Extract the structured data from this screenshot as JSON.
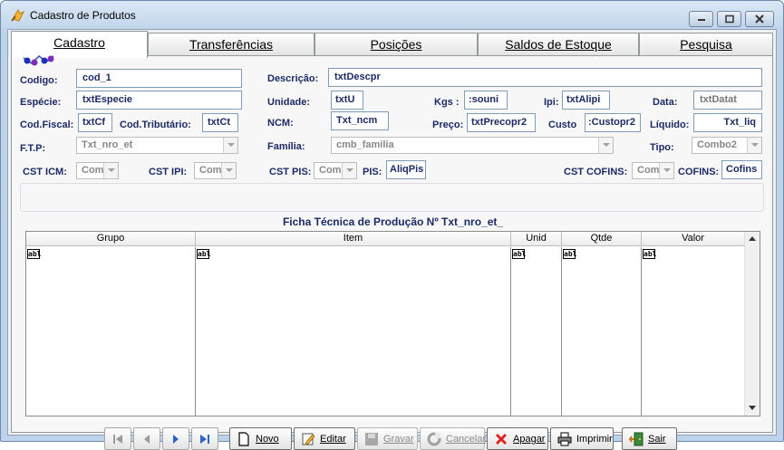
{
  "window": {
    "title": "Cadastro de Produtos"
  },
  "tabs": [
    {
      "label": "Cadastro"
    },
    {
      "label": "Transferências"
    },
    {
      "label": "Posições"
    },
    {
      "label": "Saldos de Estoque"
    },
    {
      "label": "Pesquisa"
    }
  ],
  "labels": {
    "codigo": "Codigo:",
    "descricao": "Descrição:",
    "especie": "Espécie:",
    "unidade": "Unidade:",
    "kgs": "Kgs :",
    "ipi": "Ipi:",
    "data": "Data:",
    "cod_fiscal": "Cod.Fiscal:",
    "cod_tributario": "Cod.Tributário:",
    "ncm": "NCM:",
    "preco": "Preço:",
    "custo": "Custo",
    "liquido": "Líquido:",
    "ftp": "F.T.P:",
    "familia": "Família:",
    "tipo": "Tipo:",
    "cst_icm": "CST ICM:",
    "cst_ipi": "CST IPI:",
    "cst_pis": "CST PIS:",
    "pis": "PIS:",
    "cst_cofins": "CST COFINS:",
    "cofins": "COFINS:"
  },
  "fields": {
    "codigo": "cod_1",
    "descricao": "txtDescpr",
    "especie": "txtEspecie",
    "unidade": "txtU",
    "kgs": ":souni",
    "ipi": "txtAlipi",
    "data": "txtDatat",
    "cod_fiscal": "txtCf",
    "cod_tributario": "txtCt",
    "ncm": "Txt_ncm",
    "preco": "txtPrecopr2",
    "custo": ":Custopr2",
    "liquido": "Txt_liq",
    "ftp": "Txt_nro_et",
    "familia": "cmb_familia",
    "tipo": "Combo2",
    "cst_icm": "Com",
    "cst_ipi": "Com",
    "cst_pis": "Com",
    "pis": "AliqPis",
    "cst_cofins": "Com",
    "cofins": "Cofins"
  },
  "section": {
    "title": "Ficha Técnica de Produção Nº   Txt_nro_et_"
  },
  "grid": {
    "columns": [
      "Grupo",
      "Item",
      "Unid",
      "Qtde",
      "Valor"
    ],
    "cell_icon": "abl"
  },
  "actions": {
    "novo": "Novo",
    "editar": "Editar",
    "gravar": "Gravar",
    "cancelar": "Cancelar",
    "apagar": "Apagar",
    "imprimir": "Imprimir",
    "sair": "Sair"
  }
}
